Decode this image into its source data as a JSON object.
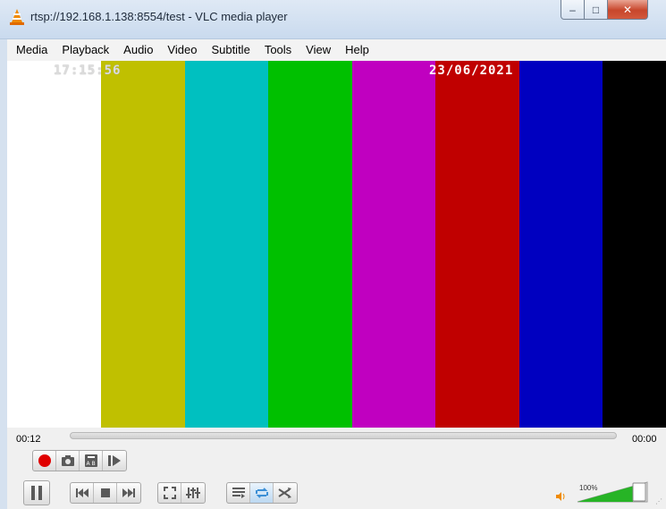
{
  "window": {
    "title": "rtsp://192.168.1.138:8554/test - VLC media player",
    "minimize_label": "–",
    "maximize_label": "□",
    "close_label": "✕"
  },
  "menu": {
    "items": [
      "Media",
      "Playback",
      "Audio",
      "Video",
      "Subtitle",
      "Tools",
      "View",
      "Help"
    ]
  },
  "video": {
    "osd_time": "17:15:56",
    "osd_date": "23/06/2021",
    "color_bars": [
      "#ffffff",
      "#c0c000",
      "#00c0c0",
      "#00c000",
      "#c000c0",
      "#c00000",
      "#0000c0",
      "#000000"
    ]
  },
  "playback": {
    "elapsed": "00:12",
    "total": "00:00",
    "progress_fraction": 0.0
  },
  "volume": {
    "label": "100%",
    "level_fraction": 1.0
  },
  "controls": {
    "row1": [
      "record-icon",
      "snapshot-icon",
      "ab-loop-icon",
      "frame-step-icon"
    ],
    "row2": [
      "pause-icon",
      "previous-icon",
      "stop-icon",
      "next-icon",
      "fullscreen-icon",
      "extended-settings-icon",
      "playlist-icon",
      "loop-icon",
      "shuffle-icon"
    ]
  },
  "colors": {
    "accent": "#3c8fd6",
    "record": "#e00000",
    "volume_fill": "#27b426"
  }
}
